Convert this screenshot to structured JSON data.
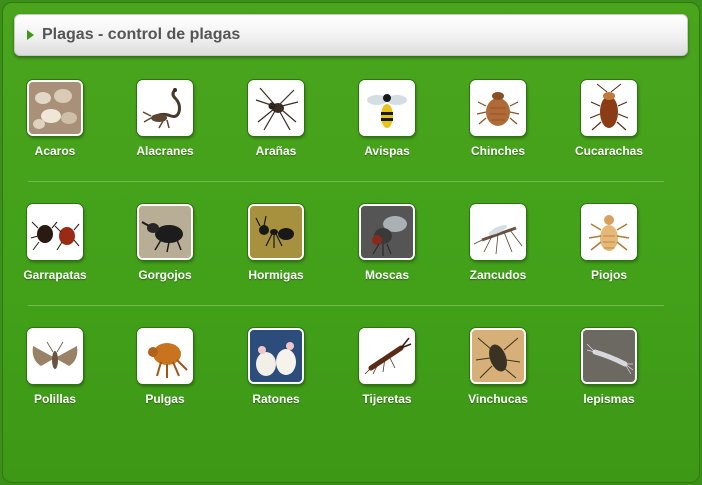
{
  "header": {
    "title": "Plagas - control de plagas"
  },
  "colors": {
    "background": "#42a019",
    "header_arrow": "#3a9a15",
    "label": "#ffffff"
  },
  "rows": [
    {
      "items": [
        {
          "label": "Acaros",
          "icon": "mite-cluster-icon"
        },
        {
          "label": "Alacranes",
          "icon": "scorpion-icon"
        },
        {
          "label": "Arañas",
          "icon": "spider-icon"
        },
        {
          "label": "Avispas",
          "icon": "wasp-icon"
        },
        {
          "label": "Chinches",
          "icon": "bedbug-icon"
        },
        {
          "label": "Cucarachas",
          "icon": "cockroach-icon"
        }
      ]
    },
    {
      "items": [
        {
          "label": "Garrapatas",
          "icon": "tick-icon"
        },
        {
          "label": "Gorgojos",
          "icon": "weevil-icon"
        },
        {
          "label": "Hormigas",
          "icon": "ant-icon"
        },
        {
          "label": "Moscas",
          "icon": "fly-icon"
        },
        {
          "label": "Zancudos",
          "icon": "mosquito-icon"
        },
        {
          "label": "Piojos",
          "icon": "louse-icon"
        }
      ]
    },
    {
      "items": [
        {
          "label": "Polillas",
          "icon": "moth-icon"
        },
        {
          "label": "Pulgas",
          "icon": "flea-icon"
        },
        {
          "label": "Ratones",
          "icon": "mouse-icon"
        },
        {
          "label": "Tijeretas",
          "icon": "earwig-icon"
        },
        {
          "label": "Vinchucas",
          "icon": "kissing-bug-icon"
        },
        {
          "label": "lepismas",
          "icon": "silverfish-icon"
        }
      ]
    }
  ]
}
